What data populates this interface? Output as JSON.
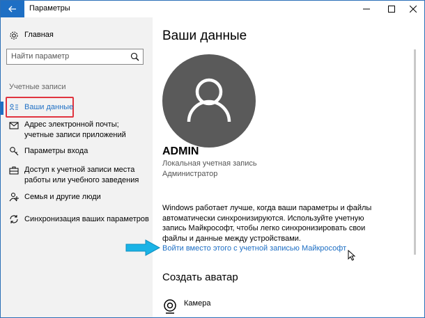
{
  "window": {
    "title": "Параметры"
  },
  "sidebar": {
    "home_label": "Главная",
    "search_placeholder": "Найти параметр",
    "section_label": "Учетные записи",
    "items": [
      {
        "label": "Ваши данные",
        "icon": "person-card-icon"
      },
      {
        "label": "Адрес электронной почты; учетные записи приложений",
        "icon": "mail-icon"
      },
      {
        "label": "Параметры входа",
        "icon": "key-icon"
      },
      {
        "label": "Доступ к учетной записи места работы или учебного заведения",
        "icon": "briefcase-icon"
      },
      {
        "label": "Семья и другие люди",
        "icon": "people-icon"
      },
      {
        "label": "Синхронизация ваших параметров",
        "icon": "sync-icon"
      }
    ]
  },
  "main": {
    "heading": "Ваши данные",
    "username": "ADMIN",
    "account_type": "Локальная учетная запись",
    "role": "Администратор",
    "info_text": "Windows работает лучше, когда ваши параметры и файлы автоматически синхронизируются. Используйте учетную запись Майкрософт, чтобы легко синхронизировать свои файлы и данные между устройствами.",
    "link": "Войти вместо этого с учетной записью Майкрософт",
    "avatar_heading": "Создать аватар",
    "camera_label": "Камера"
  },
  "colors": {
    "accent": "#1e6fc4",
    "highlight": "#e0343f",
    "avatar_bg": "#5a5a5a",
    "sidebar_bg": "#f2f2f2",
    "arrow": "#1ab3e6"
  }
}
